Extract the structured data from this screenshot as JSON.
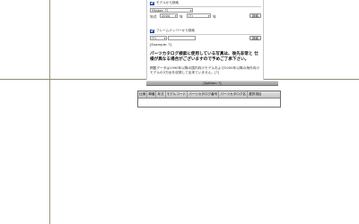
{
  "colors": {
    "accent": "#1e4b99",
    "divider": "#9c9480",
    "header_bg": "#c5c5c5",
    "splitter_bg": "#a6a6a6"
  },
  "model_search": {
    "title": "モデルから検索",
    "maker_value": "[Maker: ?]",
    "year_label": "年式",
    "year_value": "2004",
    "year_unit": "年",
    "range_select_value": "[?]",
    "range_unit": "年",
    "search_button": "検索"
  },
  "frame_search": {
    "title": "フレームナンバーから検索",
    "select_value": "[?]",
    "input_value": "",
    "search_button": "検索",
    "example": "[Example: ?]"
  },
  "notice": {
    "bold": "パーツカタログ検索に使用している写真は、後先非常と 仕様が異なる場合がございますので予めご了承下さい。",
    "body": "掲載データは1990年以降の国内向けモデルおよび2000年以降の海外向けモデルの3万台を収録して出来ていません。[?]"
  },
  "splitter": {
    "label": "[Splitter: ?]"
  },
  "table": {
    "headers": [
      "仕様",
      "車種",
      "年式",
      "モデルコード",
      "パーツカタログ番号",
      "パーツカタログ名",
      "選択項目"
    ]
  }
}
